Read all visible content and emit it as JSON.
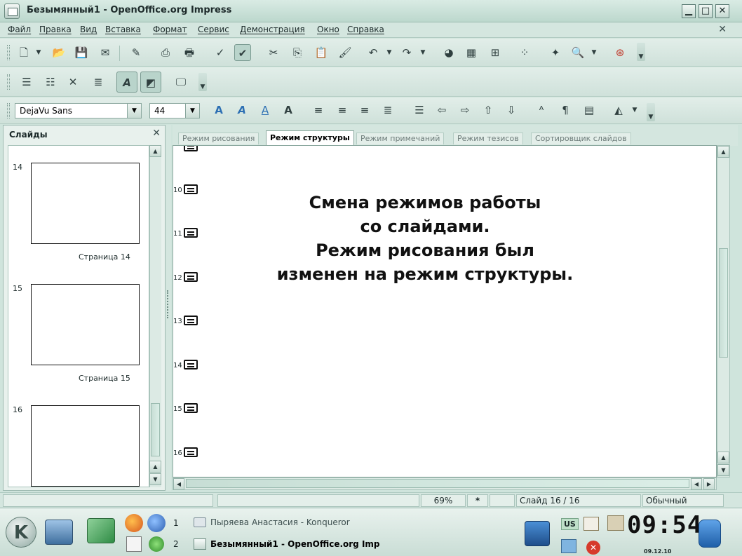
{
  "window": {
    "title": "Безымянный1 - OpenOffice.org Impress",
    "minimize": "▁",
    "maximize": "□",
    "close": "✕",
    "doc_close": "✕"
  },
  "menu": [
    "Файл",
    "Правка",
    "Вид",
    "Вставка",
    "Формат",
    "Сервис",
    "Демонстрация",
    "Окно",
    "Справка"
  ],
  "format_toolbar": {
    "font_name": "DejaVu Sans",
    "font_size": "44"
  },
  "slides_pane": {
    "title": "Слайды",
    "close": "✕",
    "slides": [
      {
        "number": "14",
        "caption": "Страница 14"
      },
      {
        "number": "15",
        "caption": "Страница 15"
      },
      {
        "number": "16",
        "caption": ""
      }
    ]
  },
  "view_tabs": [
    {
      "label": "Режим рисования",
      "active": false
    },
    {
      "label": "Режим структуры",
      "active": true
    },
    {
      "label": "Режим примечаний",
      "active": false
    },
    {
      "label": "Режим тезисов",
      "active": false
    },
    {
      "label": "Сортировщик слайдов",
      "active": false
    }
  ],
  "outline_rows": [
    "10",
    "11",
    "12",
    "13",
    "14",
    "15",
    "16"
  ],
  "annotation": {
    "lines": [
      "Смена режимов работы",
      "со слайдами.",
      "Режим рисования был",
      "изменен на режим структуры."
    ]
  },
  "status": {
    "zoom": "69%",
    "modified": "*",
    "slide": "Слайд 16 / 16",
    "layout": "Обычный"
  },
  "taskbar": {
    "task1_num": "1",
    "task1_label": "Пыряева Анастасия - Konqueror",
    "task2_num": "2",
    "task2_label": "Безымянный1 - OpenOffice.org Imp",
    "kb_layout": "US",
    "clock": "09:54",
    "date": "09.12.10"
  },
  "colors": {
    "chrome": "#d4e6df",
    "accent_border": "#8aa79e",
    "text": "#1b2929"
  }
}
